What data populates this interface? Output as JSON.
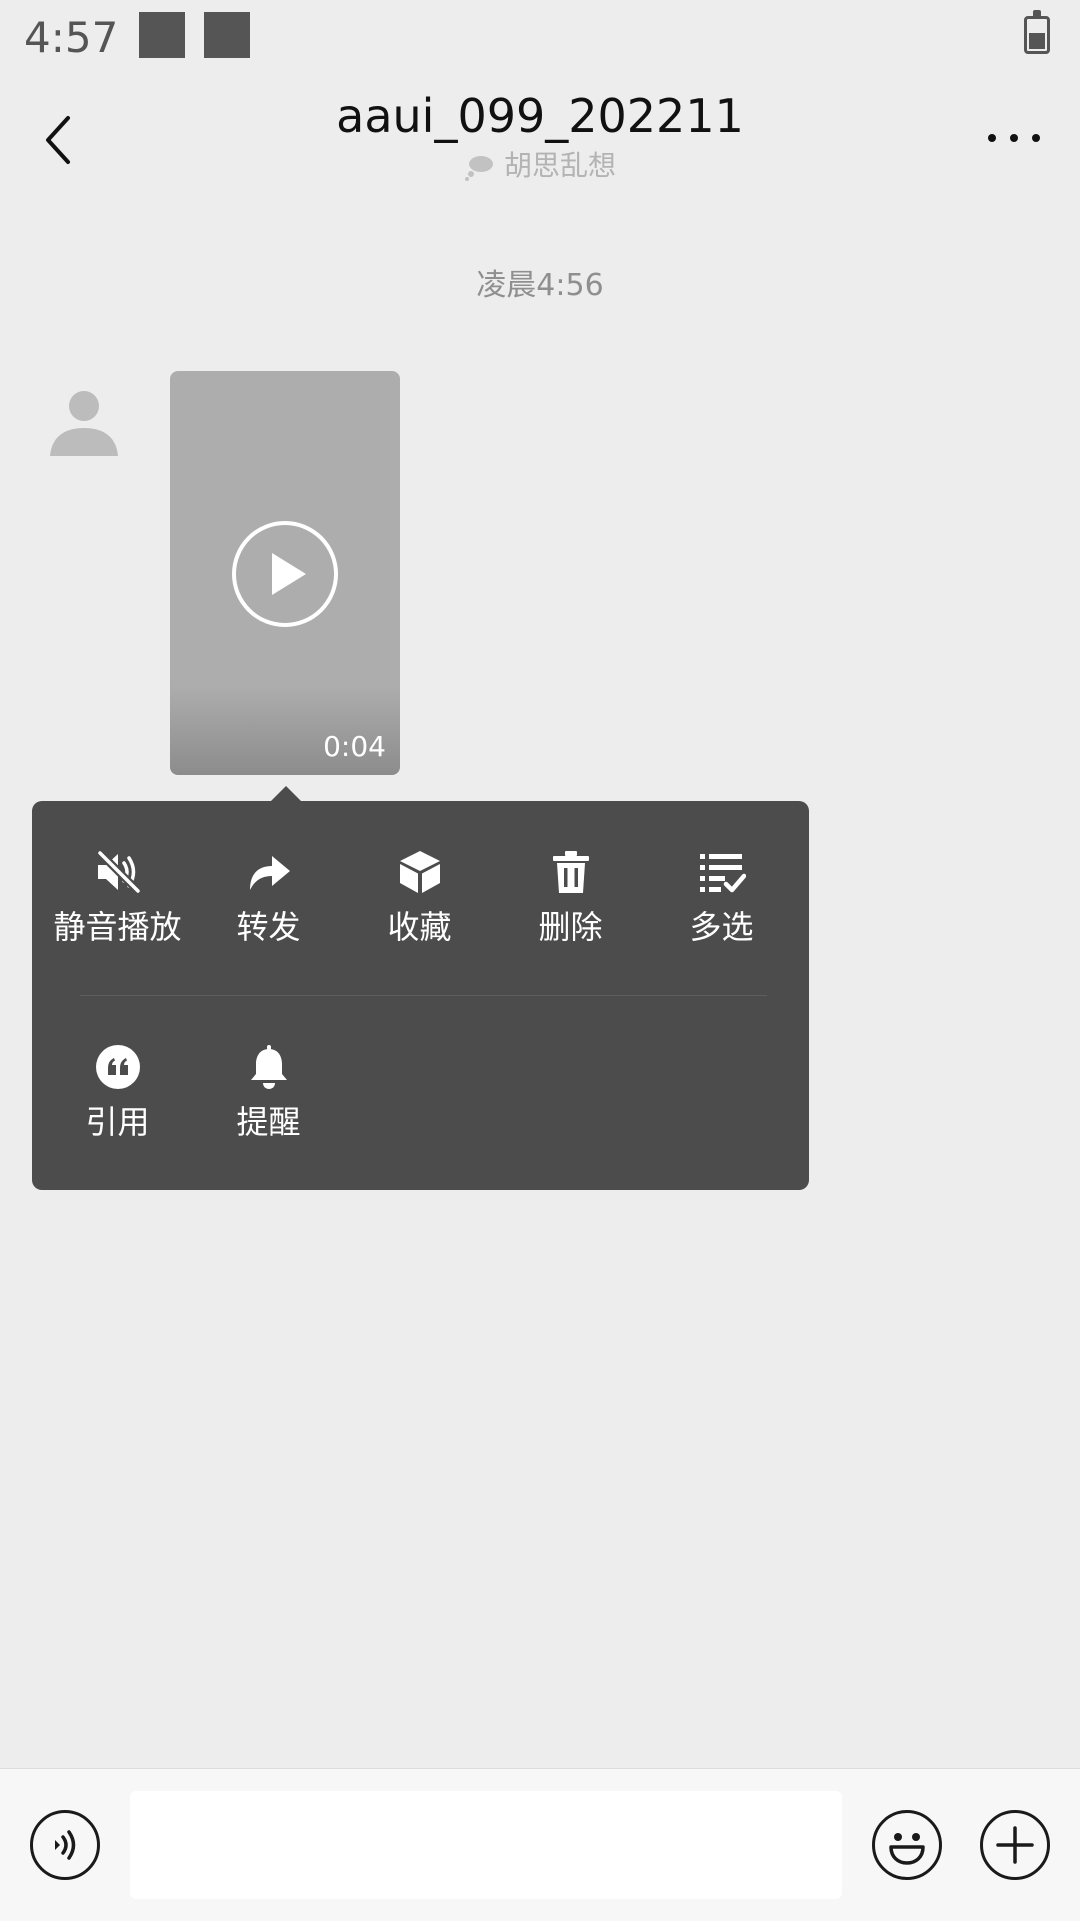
{
  "status_bar": {
    "time": "4:57"
  },
  "header": {
    "title": "aaui_099_202211",
    "subtitle": "胡思乱想"
  },
  "chat": {
    "timestamp": "凌晨4:56",
    "video_message": {
      "duration": "0:04"
    }
  },
  "context_menu": {
    "items": [
      {
        "label": "静音播放",
        "icon": "mute-speaker-icon"
      },
      {
        "label": "转发",
        "icon": "forward-icon"
      },
      {
        "label": "收藏",
        "icon": "favorite-cube-icon"
      },
      {
        "label": "删除",
        "icon": "trash-icon"
      },
      {
        "label": "多选",
        "icon": "multi-select-icon"
      },
      {
        "label": "引用",
        "icon": "quote-icon"
      },
      {
        "label": "提醒",
        "icon": "bell-icon"
      }
    ]
  },
  "input_bar": {
    "placeholder": ""
  },
  "colors": {
    "background": "#ededed",
    "menu": "#4c4c4c",
    "text": "#111111"
  }
}
